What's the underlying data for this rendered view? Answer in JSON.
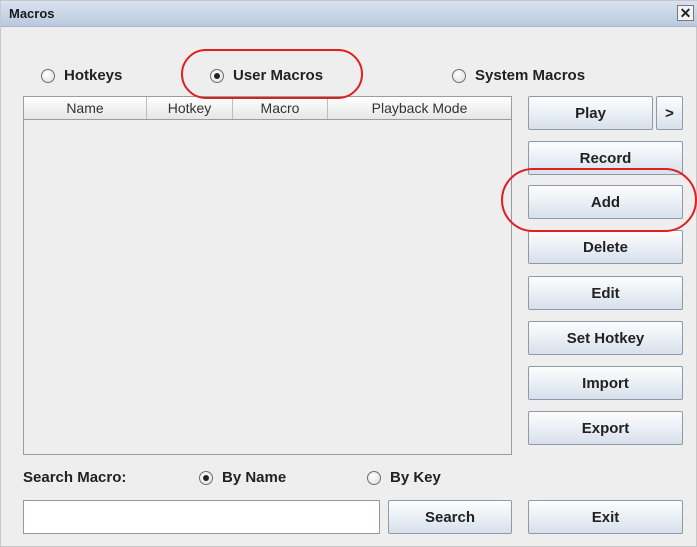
{
  "window": {
    "title": "Macros",
    "close_glyph": "✕"
  },
  "mode_radios": [
    {
      "label": "Hotkeys",
      "checked": false
    },
    {
      "label": "User Macros",
      "checked": true
    },
    {
      "label": "System Macros",
      "checked": false
    }
  ],
  "table": {
    "columns": [
      "Name",
      "Hotkey",
      "Macro",
      "Playback Mode"
    ],
    "rows": []
  },
  "buttons": {
    "play": "Play",
    "play_more": ">",
    "record": "Record",
    "add": "Add",
    "delete": "Delete",
    "edit": "Edit",
    "set_hotkey": "Set Hotkey",
    "import": "Import",
    "export": "Export",
    "search": "Search",
    "exit": "Exit"
  },
  "search": {
    "label": "Search Macro:",
    "by_name": {
      "label": "By Name",
      "checked": true
    },
    "by_key": {
      "label": "By Key",
      "checked": false
    },
    "value": ""
  },
  "colors": {
    "annotation": "#e02020",
    "button_border": "#8e9aa8",
    "panel_bg": "#eeeeee"
  }
}
